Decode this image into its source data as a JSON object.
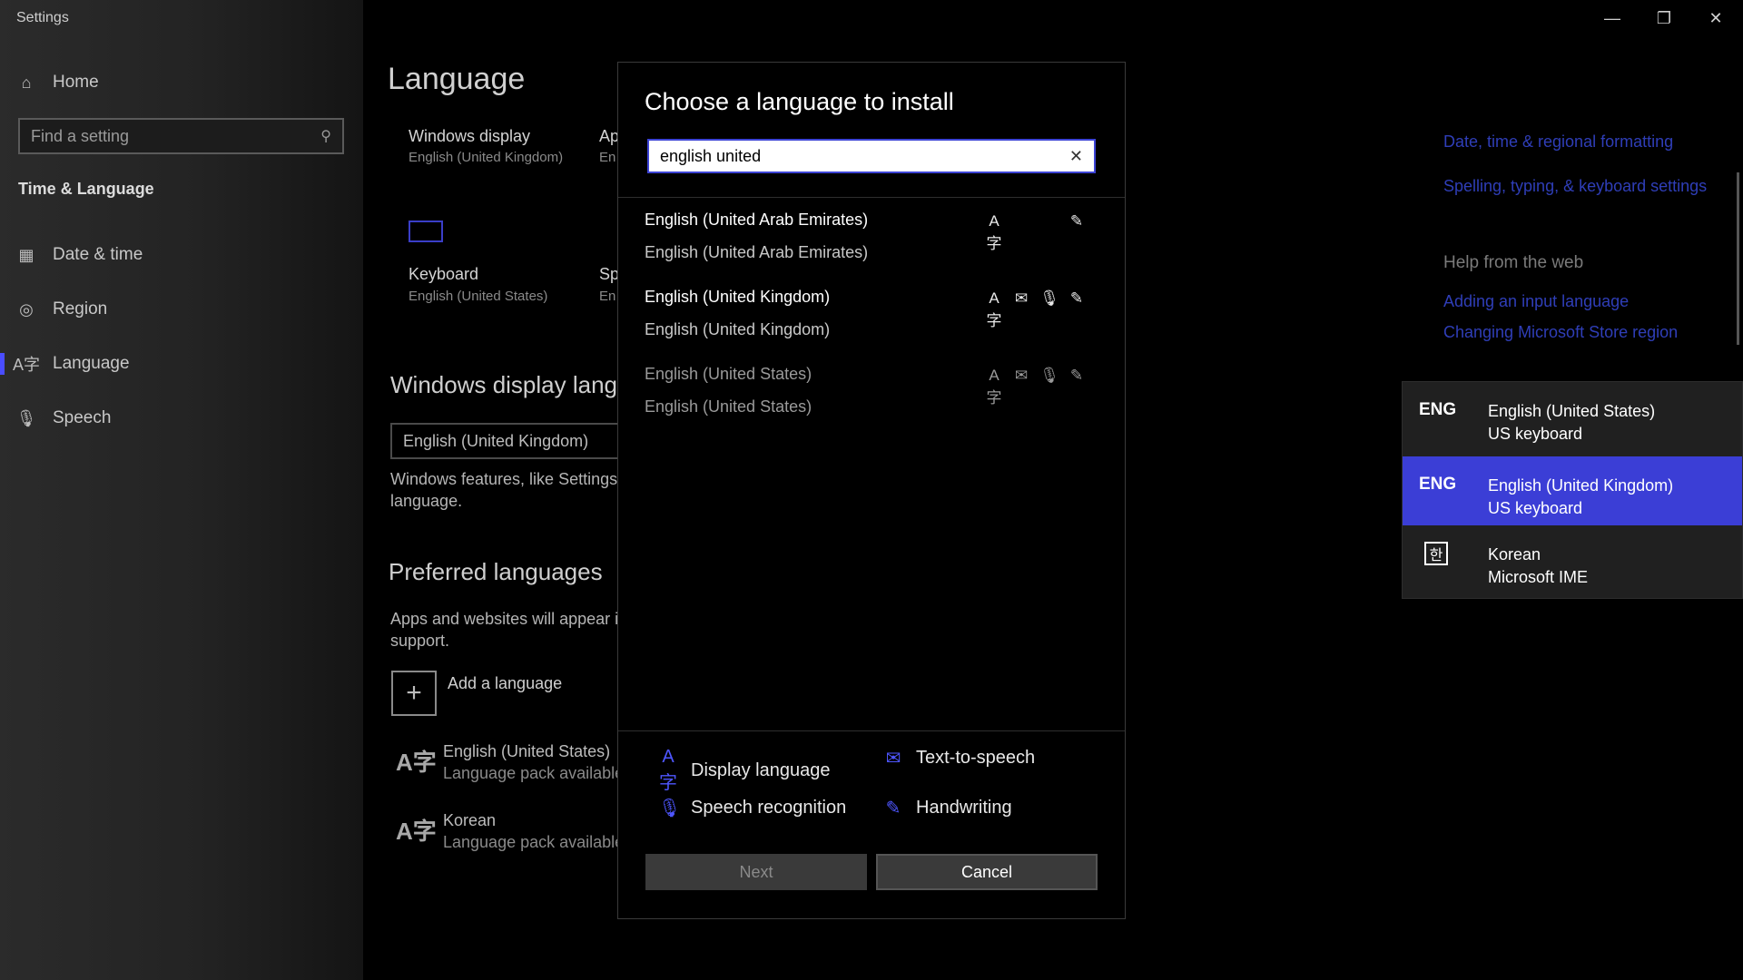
{
  "window": {
    "title": "Settings",
    "controls": [
      "minimize-icon",
      "restore-icon",
      "close-icon"
    ]
  },
  "sidebar": {
    "home": "Home",
    "search_placeholder": "Find a setting",
    "section": "Time & Language",
    "items": [
      {
        "label": "Date & time",
        "icon": "calendar-clock-icon"
      },
      {
        "label": "Region",
        "icon": "globe-icon"
      },
      {
        "label": "Language",
        "icon": "language-icon",
        "active": true
      },
      {
        "label": "Speech",
        "icon": "microphone-icon"
      }
    ]
  },
  "page": {
    "title": "Language",
    "tiles": [
      {
        "title": "Windows display",
        "sub": "English (United Kingdom)"
      },
      {
        "title": "Ap",
        "sub": "En"
      },
      {
        "title": "Keyboard",
        "sub": "English (United States)"
      },
      {
        "title": "Sp",
        "sub": "En"
      }
    ],
    "display_heading": "Windows display langu",
    "display_dropdown": "English (United Kingdom)",
    "display_desc_1": "Windows features, like Settings a",
    "display_desc_2": "language.",
    "preferred_heading": "Preferred languages",
    "preferred_desc_1": "Apps and websites will appear in",
    "preferred_desc_2": "support.",
    "add_language": "Add a language",
    "languages": [
      {
        "name": "English (United States)",
        "status": "Language pack available"
      },
      {
        "name": "Korean",
        "status": "Language pack available"
      }
    ]
  },
  "related": {
    "links": [
      "Date, time & regional formatting",
      "Spelling, typing, & keyboard settings"
    ],
    "help_heading": "Help from the web",
    "help_links": [
      "Adding an input language",
      "Changing Microsoft Store region"
    ]
  },
  "dialog": {
    "title": "Choose a language to install",
    "search_value": "english united",
    "results": [
      {
        "name": "English (United Arab Emirates)",
        "native": "English (United Arab Emirates)",
        "features": [
          "display-language-icon",
          "handwriting-icon"
        ]
      },
      {
        "name": "English (United Kingdom)",
        "native": "English (United Kingdom)",
        "features": [
          "display-language-icon",
          "text-to-speech-icon",
          "speech-recognition-icon",
          "handwriting-icon"
        ]
      },
      {
        "name": "English (United States)",
        "native": "English (United States)",
        "features": [
          "display-language-icon",
          "text-to-speech-icon",
          "speech-recognition-icon",
          "handwriting-icon"
        ],
        "installed": true
      }
    ],
    "legend": {
      "display_language": "Display language",
      "text_to_speech": "Text-to-speech",
      "speech_recognition": "Speech recognition",
      "handwriting": "Handwriting"
    },
    "next_label": "Next",
    "cancel_label": "Cancel"
  },
  "input_switcher": {
    "items": [
      {
        "code": "ENG",
        "line1": "English (United States)",
        "line2": "US keyboard"
      },
      {
        "code": "ENG",
        "line1": "English (United Kingdom)",
        "line2": "US keyboard",
        "selected": true
      },
      {
        "code": "",
        "icon": "korean-ime-icon",
        "line1": "Korean",
        "line2": "Microsoft IME"
      }
    ]
  },
  "colors": {
    "accent": "#3b3ed6",
    "link": "#2f3eb8",
    "legend_icon": "#4e56ff"
  }
}
